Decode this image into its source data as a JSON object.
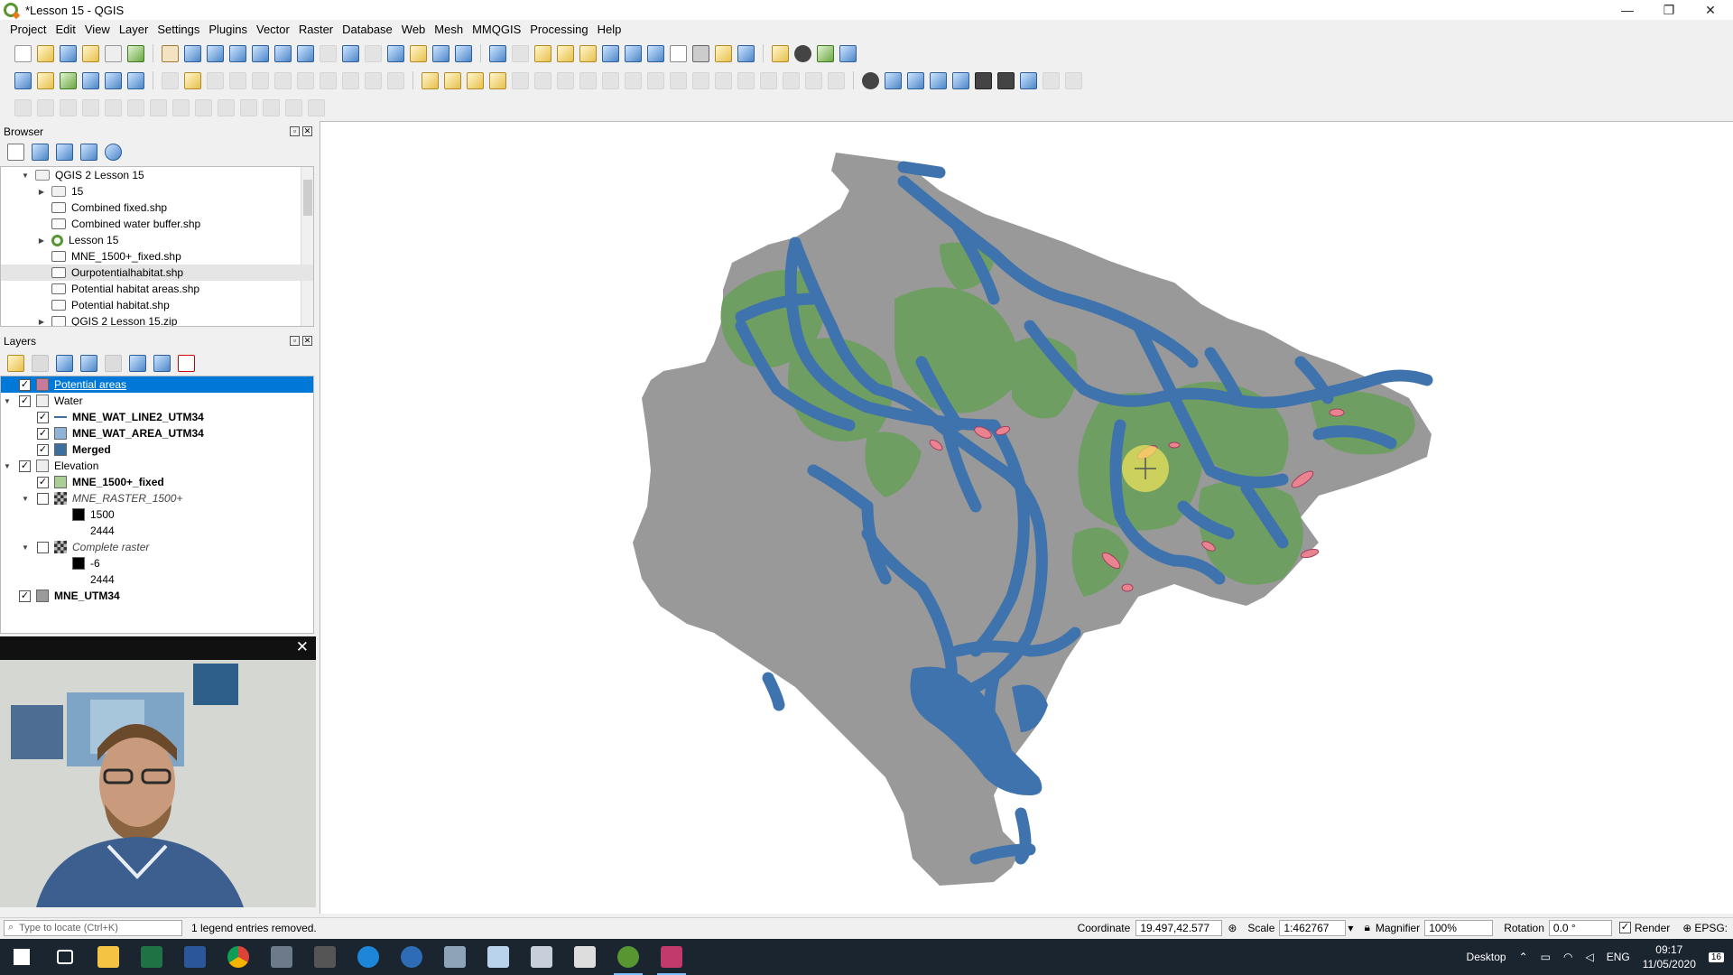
{
  "window": {
    "title": "*Lesson 15 - QGIS",
    "controls": [
      "—",
      "❐",
      "✕"
    ]
  },
  "menu": [
    "Project",
    "Edit",
    "View",
    "Layer",
    "Settings",
    "Plugins",
    "Vector",
    "Raster",
    "Database",
    "Web",
    "Mesh",
    "MMQGIS",
    "Processing",
    "Help"
  ],
  "browser": {
    "title": "Browser",
    "items": [
      {
        "label": "QGIS 2 Lesson 15",
        "indent": 1,
        "arrow": "▼",
        "icon": "folder"
      },
      {
        "label": "15",
        "indent": 2,
        "arrow": "▶",
        "icon": "folder"
      },
      {
        "label": "Combined fixed.shp",
        "indent": 2,
        "arrow": "",
        "icon": "polygon"
      },
      {
        "label": "Combined water buffer.shp",
        "indent": 2,
        "arrow": "",
        "icon": "polygon"
      },
      {
        "label": "Lesson 15",
        "indent": 2,
        "arrow": "▶",
        "icon": "qgis"
      },
      {
        "label": "MNE_1500+_fixed.shp",
        "indent": 2,
        "arrow": "",
        "icon": "polygon"
      },
      {
        "label": "Ourpotentialhabitat.shp",
        "indent": 2,
        "arrow": "",
        "icon": "polygon"
      },
      {
        "label": "Potential habitat areas.shp",
        "indent": 2,
        "arrow": "",
        "icon": "polygon"
      },
      {
        "label": "Potential habitat.shp",
        "indent": 2,
        "arrow": "",
        "icon": "polygon"
      },
      {
        "label": "QGIS 2 Lesson 15.zip",
        "indent": 2,
        "arrow": "▶",
        "icon": "zip"
      }
    ]
  },
  "layers": {
    "title": "Layers",
    "items": [
      {
        "label": "Potential areas",
        "indent": 0,
        "arrow": "",
        "checked": true,
        "swatch": "#c77a9a",
        "style": "sel"
      },
      {
        "label": "Water",
        "indent": 0,
        "arrow": "▼",
        "checked": true,
        "swatch": "group",
        "style": ""
      },
      {
        "label": "MNE_WAT_LINE2_UTM34",
        "indent": 1,
        "arrow": "",
        "checked": true,
        "swatch": "line",
        "style": "bold"
      },
      {
        "label": "MNE_WAT_AREA_UTM34",
        "indent": 1,
        "arrow": "",
        "checked": true,
        "swatch": "#8fb3d9",
        "style": "bold"
      },
      {
        "label": "Merged",
        "indent": 1,
        "arrow": "",
        "checked": true,
        "swatch": "#3c6f9f",
        "style": "bold"
      },
      {
        "label": "Elevation",
        "indent": 0,
        "arrow": "▼",
        "checked": true,
        "swatch": "group",
        "style": ""
      },
      {
        "label": "MNE_1500+_fixed",
        "indent": 1,
        "arrow": "",
        "checked": true,
        "swatch": "#a9cf96",
        "style": "bold"
      },
      {
        "label": "MNE_RASTER_1500+",
        "indent": 1,
        "arrow": "▼",
        "checked": false,
        "swatch": "raster",
        "style": "ital"
      },
      {
        "label": "1500",
        "indent": 2,
        "arrow": "",
        "checked": null,
        "swatch": "#000000",
        "style": ""
      },
      {
        "label": "2444",
        "indent": 2,
        "arrow": "",
        "checked": null,
        "swatch": "none",
        "style": ""
      },
      {
        "label": "Complete raster",
        "indent": 1,
        "arrow": "▼",
        "checked": false,
        "swatch": "raster",
        "style": "ital"
      },
      {
        "label": "-6",
        "indent": 2,
        "arrow": "",
        "checked": null,
        "swatch": "#000000",
        "style": ""
      },
      {
        "label": "2444",
        "indent": 2,
        "arrow": "",
        "checked": null,
        "swatch": "none",
        "style": ""
      },
      {
        "label": "MNE_UTM34",
        "indent": 0,
        "arrow": "",
        "checked": true,
        "swatch": "#9a9a9a",
        "style": "bold"
      }
    ]
  },
  "map_colors": {
    "land": "#999999",
    "highland": "#6e9e62",
    "water": "#3f73ad",
    "potential": "#e8838f"
  },
  "status": {
    "locate_placeholder": "Type to locate (Ctrl+K)",
    "message": "1 legend entries removed.",
    "coordinate_label": "Coordinate",
    "coordinate_value": "19.497,42.577",
    "scale_label": "Scale",
    "scale_value": "1:462767",
    "magnifier_label": "Magnifier",
    "magnifier_value": "100%",
    "rotation_label": "Rotation",
    "rotation_value": "0.0 °",
    "render_label": "Render",
    "crs_label": "EPSG:"
  },
  "taskbar": {
    "desktop": "Desktop",
    "lang": "ENG",
    "time": "09:17",
    "date": "11/05/2020",
    "notif": "16"
  }
}
